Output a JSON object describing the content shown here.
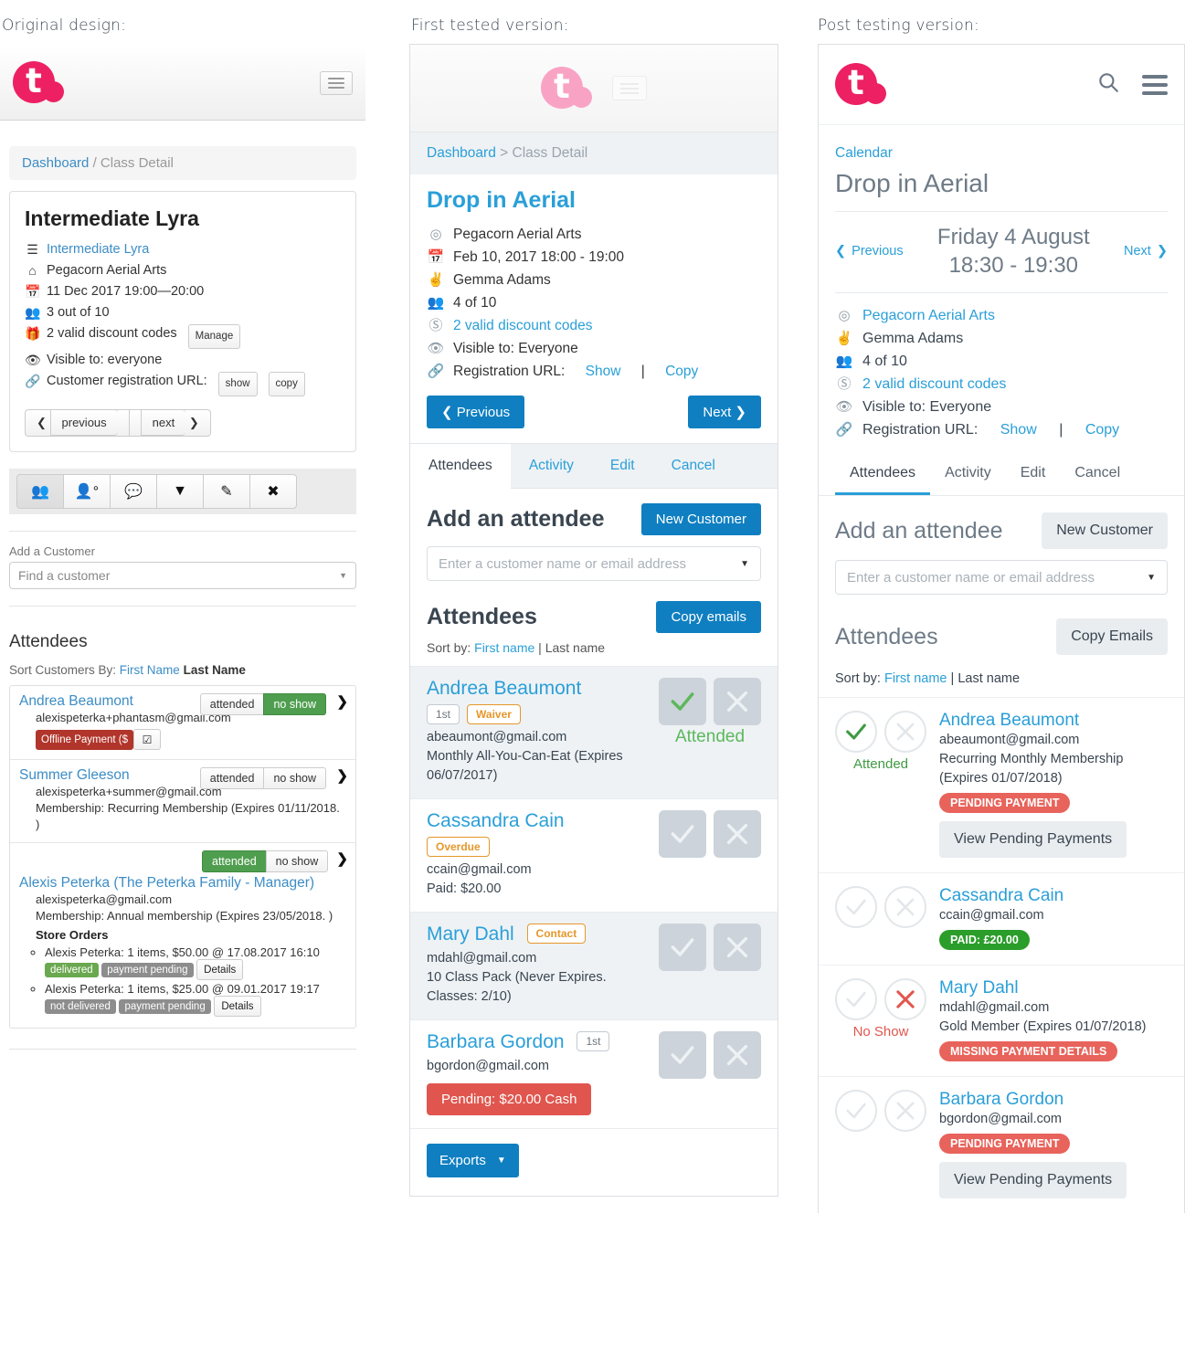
{
  "captions": {
    "original": "Original design:",
    "first_tested": "First tested version:",
    "post_testing": "Post testing version:"
  },
  "colors": {
    "brand_pink": "#ed2064",
    "brand_pink_pale": "#f9a3c4",
    "link_blue": "#2a9fd8",
    "primary_blue": "#0f7fc1",
    "green": "#5cb85c",
    "red": "#e0564e",
    "orange": "#e5972a",
    "grey_btn": "#e9edf0"
  },
  "original": {
    "logo_letter": "t",
    "breadcrumb": {
      "link": "Dashboard",
      "sep": "/",
      "current": "Class Detail"
    },
    "title": "Intermediate Lyra",
    "meta": [
      {
        "icon": "list-icon",
        "text": "Intermediate Lyra",
        "link": true
      },
      {
        "icon": "home-icon",
        "text": "Pegacorn Aerial Arts",
        "link": false
      },
      {
        "icon": "calendar-icon",
        "text": "11 Dec 2017 19:00—20:00",
        "link": false
      },
      {
        "icon": "people-icon",
        "text": "3 out of 10",
        "link": false
      },
      {
        "icon": "gift-icon",
        "text": "2 valid discount codes",
        "link": false,
        "button": "Manage"
      },
      {
        "icon": "eye-icon",
        "text": "Visible to: everyone",
        "link": false
      },
      {
        "icon": "link-icon",
        "text": "Customer registration URL:",
        "link": false,
        "buttons": [
          "show",
          "copy"
        ]
      }
    ],
    "prev_label": "previous",
    "next_label": "next",
    "toolbar_icons": [
      "attendees-group-icon",
      "add-person-icon",
      "comment-icon",
      "download-icon",
      "edit-pencil-icon",
      "cancel-circle-icon"
    ],
    "add_customer_label": "Add a Customer",
    "find_customer_placeholder": "Find a customer",
    "attendees_heading": "Attendees",
    "sort_prefix": "Sort Customers By:",
    "sort_first": "First Name",
    "sort_last": "Last Name",
    "attended_label": "attended",
    "noshow_label": "no show",
    "attendees": [
      {
        "name": "Andrea Beaumont",
        "email": "alexispeterka+phantasm@gmail.com",
        "state": "no show",
        "tag_red": "Offline Payment ($",
        "has_check_button": true
      },
      {
        "name": "Summer Gleeson",
        "email": "alexispeterka+summer@gmail.com",
        "membership": "Membership: Recurring Membership (Expires 01/11/2018. )",
        "state": "none"
      },
      {
        "name": "Alexis Peterka",
        "name_suffix": "(The Peterka Family - Manager)",
        "email": "alexispeterka@gmail.com",
        "membership": "Membership: Annual membership (Expires 23/05/2018. )",
        "state": "attended",
        "store_orders_heading": "Store Orders",
        "orders": [
          {
            "text": "Alexis Peterka: 1 items, $50.00 @ 17.08.2017 16:10",
            "tags": [
              {
                "label": "delivered",
                "kind": "green"
              },
              {
                "label": "payment pending",
                "kind": "grey"
              }
            ],
            "details": "Details"
          },
          {
            "text": "Alexis Peterka: 1 items, $25.00 @ 09.01.2017 19:17",
            "tags": [
              {
                "label": "not delivered",
                "kind": "grey"
              },
              {
                "label": "payment pending",
                "kind": "grey"
              }
            ],
            "details": "Details"
          }
        ]
      }
    ]
  },
  "first_tested": {
    "logo_letter": "t",
    "breadcrumb": {
      "link": "Dashboard",
      "sep": ">",
      "current": "Class Detail"
    },
    "title": "Drop in Aerial",
    "meta": [
      {
        "icon": "location-pin-icon",
        "text": "Pegacorn Aerial Arts",
        "link": false
      },
      {
        "icon": "calendar-icon",
        "text": "Feb 10, 2017 18:00 - 19:00",
        "link": false
      },
      {
        "icon": "instructor-icon",
        "text": "Gemma Adams",
        "link": false
      },
      {
        "icon": "people-icon",
        "text": "4 of 10",
        "link": false
      },
      {
        "icon": "discount-tag-icon",
        "text": "2 valid discount codes",
        "link": true
      },
      {
        "icon": "eye-icon",
        "text": "Visible to: Everyone",
        "link": false
      }
    ],
    "registration_label": "Registration URL:",
    "registration_show": "Show",
    "registration_sep": "|",
    "registration_copy": "Copy",
    "prev_label": "Previous",
    "next_label": "Next",
    "tabs": [
      {
        "label": "Attendees",
        "active": true
      },
      {
        "label": "Activity",
        "active": false
      },
      {
        "label": "Edit",
        "active": false
      },
      {
        "label": "Cancel",
        "active": false
      }
    ],
    "add_attendee_heading": "Add an attendee",
    "new_customer_button": "New Customer",
    "attendee_placeholder": "Enter a customer name or email address",
    "attendees_heading": "Attendees",
    "copy_emails_button": "Copy emails",
    "sort_prefix": "Sort by:",
    "sort_first": "First name",
    "sort_sep": "|",
    "sort_last": "Last name",
    "attendees": [
      {
        "name": "Andrea Beaumont",
        "badges": [
          {
            "label": "1st",
            "kind": "plain"
          },
          {
            "label": "Waiver",
            "kind": "orange"
          }
        ],
        "lines": [
          "abeaumont@gmail.com",
          "Monthly All-You-Can-Eat (Expires 06/07/2017)"
        ],
        "state": "attended",
        "state_label": "Attended",
        "alt": true
      },
      {
        "name": "Cassandra Cain",
        "badges": [
          {
            "label": "Overdue",
            "kind": "orange"
          }
        ],
        "lines": [
          "ccain@gmail.com"
        ],
        "paid_line": "Paid: $20.00",
        "state": "none",
        "alt": false
      },
      {
        "name": "Mary Dahl",
        "inline_badge": {
          "label": "Contact",
          "kind": "orange"
        },
        "lines": [
          "mdahl@gmail.com",
          "10 Class Pack (Never Expires. Classes: 2/10)"
        ],
        "state": "none",
        "alt": true
      },
      {
        "name": "Barbara Gordon",
        "inline_badge": {
          "label": "1st",
          "kind": "plain"
        },
        "lines": [
          "bgordon@gmail.com"
        ],
        "pill_red": "Pending: $20.00 Cash",
        "state": "none",
        "alt": false
      }
    ],
    "exports_button": "Exports"
  },
  "post_testing": {
    "logo_letter": "t",
    "header_icons": [
      "search-icon",
      "hamburger-menu-icon"
    ],
    "breadcrumb": "Calendar",
    "title": "Drop in Aerial",
    "previous_label": "Previous",
    "next_label": "Next",
    "date_line1": "Friday 4 August",
    "date_line2": "18:30 - 19:30",
    "meta": [
      {
        "icon": "location-pin-icon",
        "text": "Pegacorn Aerial Arts",
        "link": true
      },
      {
        "icon": "instructor-icon",
        "text": "Gemma Adams",
        "link": false
      },
      {
        "icon": "people-icon",
        "text": "4 of 10",
        "link": false
      },
      {
        "icon": "discount-tag-icon",
        "text": "2 valid discount codes",
        "link": true
      },
      {
        "icon": "eye-icon",
        "text": "Visible to: Everyone",
        "link": false
      }
    ],
    "registration_label": "Registration URL:",
    "registration_show": "Show",
    "registration_sep": "|",
    "registration_copy": "Copy",
    "tabs": [
      {
        "label": "Attendees",
        "active": true
      },
      {
        "label": "Activity",
        "active": false
      },
      {
        "label": "Edit",
        "active": false
      },
      {
        "label": "Cancel",
        "active": false
      }
    ],
    "add_attendee_heading": "Add an attendee",
    "new_customer_button": "New Customer",
    "attendee_placeholder": "Enter a customer name or email address",
    "attendees_heading": "Attendees",
    "copy_emails_button": "Copy Emails",
    "sort_prefix": "Sort by:",
    "sort_first": "First name",
    "sort_sep": "|",
    "sort_last": "Last name",
    "view_pending_button": "View Pending Payments",
    "attendees": [
      {
        "name": "Andrea Beaumont",
        "lines": [
          "abeaumont@gmail.com",
          "Recurring Monthly Membership (Expires 01/07/2018)"
        ],
        "state": "attended",
        "state_label": "Attended",
        "pill": {
          "label": "PENDING PAYMENT",
          "kind": "red"
        },
        "view_pending": true
      },
      {
        "name": "Cassandra Cain",
        "lines": [
          "ccain@gmail.com"
        ],
        "state": "none",
        "pill": {
          "label": "PAID: £20.00",
          "kind": "green"
        },
        "view_pending": false
      },
      {
        "name": "Mary Dahl",
        "lines": [
          "mdahl@gmail.com",
          "Gold Member (Expires 01/07/2018)"
        ],
        "state": "noshow",
        "state_label": "No Show",
        "pill": {
          "label": "MISSING PAYMENT DETAILS",
          "kind": "red"
        },
        "view_pending": false
      },
      {
        "name": "Barbara Gordon",
        "lines": [
          "bgordon@gmail.com"
        ],
        "state": "none",
        "pill": {
          "label": "PENDING PAYMENT",
          "kind": "red"
        },
        "view_pending": true
      }
    ]
  }
}
